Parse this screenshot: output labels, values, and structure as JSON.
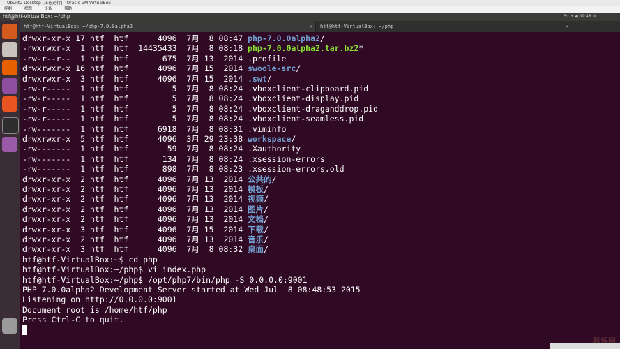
{
  "vbox": {
    "title": "Ubuntu-Desktop [正在运行] - Oracle VM VirtualBox",
    "menu": [
      "控制",
      "视图",
      "设备",
      "帮助"
    ],
    "indicators": "En  ⟳  ◀  09:48  ⚙"
  },
  "window": {
    "title": "htf@htf-VirtualBox: ~/php"
  },
  "tabs": [
    {
      "label": "htf@htf-VirtualBox: ~/php-7.0.0alpha2"
    },
    {
      "label": "htf@htf-VirtualBox: ~/php"
    }
  ],
  "launcher": [
    {
      "name": "ubuntu-dash-icon",
      "color": "#d55a1e"
    },
    {
      "name": "files-icon",
      "color": "#c9c4bd"
    },
    {
      "name": "firefox-icon",
      "color": "#e66000"
    },
    {
      "name": "app-icon",
      "color": "#8f4fa0"
    },
    {
      "name": "software-center-icon",
      "color": "#e95420"
    },
    {
      "name": "terminal-icon",
      "color": "#2d2d2d"
    },
    {
      "name": "app2-icon",
      "color": "#9a5aa8"
    },
    {
      "name": "trash-icon",
      "color": "#9a9a9a"
    }
  ],
  "terminal": {
    "listing": [
      {
        "perm": "drwxr-xr-x",
        "n": "17",
        "u": "htf",
        "g": "htf",
        "size": "4096",
        "mon": "7月",
        "day": "8",
        "time": "08:47",
        "name": "php-7.0.0alpha2",
        "suffix": "/",
        "type": "dir"
      },
      {
        "perm": "-rwxrwxr-x",
        "n": "1",
        "u": "htf",
        "g": "htf",
        "size": "14435433",
        "mon": "7月",
        "day": "8",
        "time": "08:18",
        "name": "php-7.0.0alpha2.tar.bz2",
        "suffix": "*",
        "type": "exec"
      },
      {
        "perm": "-rw-r--r--",
        "n": "1",
        "u": "htf",
        "g": "htf",
        "size": "675",
        "mon": "7月",
        "day": "13",
        "time": "2014",
        "name": ".profile",
        "suffix": "",
        "type": "file"
      },
      {
        "perm": "drwxrwxr-x",
        "n": "16",
        "u": "htf",
        "g": "htf",
        "size": "4096",
        "mon": "7月",
        "day": "15",
        "time": "2014",
        "name": "swoole-src",
        "suffix": "/",
        "type": "dir"
      },
      {
        "perm": "drwxrwxr-x",
        "n": "3",
        "u": "htf",
        "g": "htf",
        "size": "4096",
        "mon": "7月",
        "day": "15",
        "time": "2014",
        "name": ".swt",
        "suffix": "/",
        "type": "dir"
      },
      {
        "perm": "-rw-r-----",
        "n": "1",
        "u": "htf",
        "g": "htf",
        "size": "5",
        "mon": "7月",
        "day": "8",
        "time": "08:24",
        "name": ".vboxclient-clipboard.pid",
        "suffix": "",
        "type": "file"
      },
      {
        "perm": "-rw-r-----",
        "n": "1",
        "u": "htf",
        "g": "htf",
        "size": "5",
        "mon": "7月",
        "day": "8",
        "time": "08:24",
        "name": ".vboxclient-display.pid",
        "suffix": "",
        "type": "file"
      },
      {
        "perm": "-rw-r-----",
        "n": "1",
        "u": "htf",
        "g": "htf",
        "size": "5",
        "mon": "7月",
        "day": "8",
        "time": "08:24",
        "name": ".vboxclient-draganddrop.pid",
        "suffix": "",
        "type": "file"
      },
      {
        "perm": "-rw-r-----",
        "n": "1",
        "u": "htf",
        "g": "htf",
        "size": "5",
        "mon": "7月",
        "day": "8",
        "time": "08:24",
        "name": ".vboxclient-seamless.pid",
        "suffix": "",
        "type": "file"
      },
      {
        "perm": "-rw-------",
        "n": "1",
        "u": "htf",
        "g": "htf",
        "size": "6918",
        "mon": "7月",
        "day": "8",
        "time": "08:31",
        "name": ".viminfo",
        "suffix": "",
        "type": "file"
      },
      {
        "perm": "drwxrwxr-x",
        "n": "5",
        "u": "htf",
        "g": "htf",
        "size": "4096",
        "mon": "3月",
        "day": "29",
        "time": "23:38",
        "name": "workspace",
        "suffix": "/",
        "type": "dir"
      },
      {
        "perm": "-rw-------",
        "n": "1",
        "u": "htf",
        "g": "htf",
        "size": "59",
        "mon": "7月",
        "day": "8",
        "time": "08:24",
        "name": ".Xauthority",
        "suffix": "",
        "type": "file"
      },
      {
        "perm": "-rw-------",
        "n": "1",
        "u": "htf",
        "g": "htf",
        "size": "134",
        "mon": "7月",
        "day": "8",
        "time": "08:24",
        "name": ".xsession-errors",
        "suffix": "",
        "type": "file"
      },
      {
        "perm": "-rw-------",
        "n": "1",
        "u": "htf",
        "g": "htf",
        "size": "898",
        "mon": "7月",
        "day": "8",
        "time": "08:23",
        "name": ".xsession-errors.old",
        "suffix": "",
        "type": "file"
      },
      {
        "perm": "drwxr-xr-x",
        "n": "2",
        "u": "htf",
        "g": "htf",
        "size": "4096",
        "mon": "7月",
        "day": "13",
        "time": "2014",
        "name": "公共的",
        "suffix": "/",
        "type": "dir"
      },
      {
        "perm": "drwxr-xr-x",
        "n": "2",
        "u": "htf",
        "g": "htf",
        "size": "4096",
        "mon": "7月",
        "day": "13",
        "time": "2014",
        "name": "模板",
        "suffix": "/",
        "type": "dir"
      },
      {
        "perm": "drwxr-xr-x",
        "n": "2",
        "u": "htf",
        "g": "htf",
        "size": "4096",
        "mon": "7月",
        "day": "13",
        "time": "2014",
        "name": "视频",
        "suffix": "/",
        "type": "dir"
      },
      {
        "perm": "drwxr-xr-x",
        "n": "2",
        "u": "htf",
        "g": "htf",
        "size": "4096",
        "mon": "7月",
        "day": "13",
        "time": "2014",
        "name": "图片",
        "suffix": "/",
        "type": "dir"
      },
      {
        "perm": "drwxr-xr-x",
        "n": "2",
        "u": "htf",
        "g": "htf",
        "size": "4096",
        "mon": "7月",
        "day": "13",
        "time": "2014",
        "name": "文档",
        "suffix": "/",
        "type": "dir"
      },
      {
        "perm": "drwxr-xr-x",
        "n": "3",
        "u": "htf",
        "g": "htf",
        "size": "4096",
        "mon": "7月",
        "day": "15",
        "time": "2014",
        "name": "下载",
        "suffix": "/",
        "type": "dir"
      },
      {
        "perm": "drwxr-xr-x",
        "n": "2",
        "u": "htf",
        "g": "htf",
        "size": "4096",
        "mon": "7月",
        "day": "13",
        "time": "2014",
        "name": "音乐",
        "suffix": "/",
        "type": "dir"
      },
      {
        "perm": "drwxr-xr-x",
        "n": "3",
        "u": "htf",
        "g": "htf",
        "size": "4096",
        "mon": "7月",
        "day": "8",
        "time": "08:32",
        "name": "桌面",
        "suffix": "/",
        "type": "dir"
      }
    ],
    "session": [
      "htf@htf-VirtualBox:~$ cd php",
      "htf@htf-VirtualBox:~/php$ vi index.php",
      "htf@htf-VirtualBox:~/php$ /opt/php7/bin/php -S 0.0.0.0:9001",
      "PHP 7.0.0alpha2 Development Server started at Wed Jul  8 08:48:53 2015",
      "Listening on http://0.0.0.0:9001",
      "Document root is /home/htf/php",
      "Press Ctrl-C to quit."
    ]
  },
  "watermark": "慕课网"
}
